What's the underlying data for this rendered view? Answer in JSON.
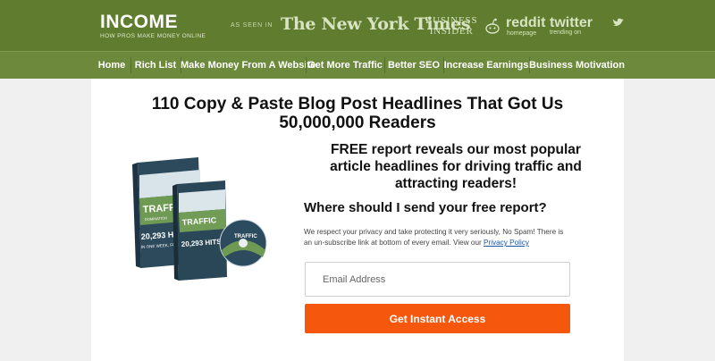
{
  "brand": {
    "logo_text": "INCOME",
    "tagline": "HOW PROS MAKE MONEY ONLINE"
  },
  "press": {
    "label": "AS SEEN IN",
    "nyt": "The New York Times",
    "business_insider": [
      "BUSINESS",
      "INSIDER"
    ],
    "reddit": {
      "name": "reddit",
      "sub": "homepage"
    },
    "twitter": {
      "name": "twitter",
      "sub": "trending on"
    }
  },
  "nav": {
    "items": [
      {
        "label": "Home"
      },
      {
        "label": "Rich List"
      },
      {
        "label": "Make Money From A Website"
      },
      {
        "label": "Get More Traffic"
      },
      {
        "label": "Better SEO"
      },
      {
        "label": "Increase Earnings"
      },
      {
        "label": "Business Motivation"
      }
    ]
  },
  "main": {
    "headline_line1": "110 Copy & Paste Blog Post Headlines That Got Us",
    "headline_line2": "50,000,000 Readers",
    "subhead_line1": "FREE report reveals our most popular",
    "subhead_line2": "article headlines for driving traffic and",
    "subhead_line3": "attracting readers!",
    "question": "Where should I send your free report?",
    "privacy_text_1": "We respect your privacy and take protecting it very seriously, No Spam! There is",
    "privacy_text_2": "an un-subscribe link at bottom of every email. View our",
    "privacy_link": "Privacy Policy",
    "email_placeholder": "Email Address",
    "cta_label": "Get Instant Access"
  },
  "product": {
    "box_title": "TRAFFIC",
    "box_subtitle": "DOMINATION",
    "box_line": "HOW THE SIMPLE BLOG POST GOT",
    "box_hits": "20,293 HITS",
    "box_tail": "IN ONE WEEK, FOR FREE!",
    "disc_title": "TRAFFIC",
    "disc_sub": "DOMINATION"
  },
  "colors": {
    "header_bg": "#5f7c2f",
    "nav_bg": "#6d8a3c",
    "cta_bg": "#f5570c"
  }
}
